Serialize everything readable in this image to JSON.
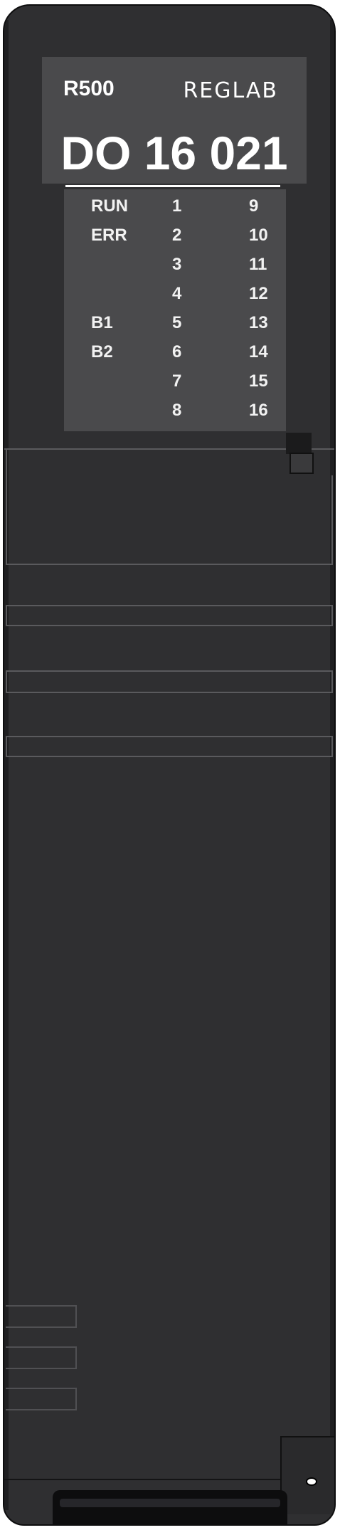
{
  "module": {
    "model": "R500",
    "brand": "REGLAB",
    "title": "DO 16 021"
  },
  "indicators": [
    {
      "status": "RUN",
      "a": "1",
      "b": "9"
    },
    {
      "status": "ERR",
      "a": "2",
      "b": "10"
    },
    {
      "status": "",
      "a": "3",
      "b": "11"
    },
    {
      "status": "",
      "a": "4",
      "b": "12"
    },
    {
      "status": "B1",
      "a": "5",
      "b": "13"
    },
    {
      "status": "B2",
      "a": "6",
      "b": "14"
    },
    {
      "status": "",
      "a": "7",
      "b": "15"
    },
    {
      "status": "",
      "a": "8",
      "b": "16"
    }
  ],
  "colors": {
    "housing": "#2f2f31",
    "label_panel": "#4a4a4c",
    "text": "#ffffff"
  }
}
